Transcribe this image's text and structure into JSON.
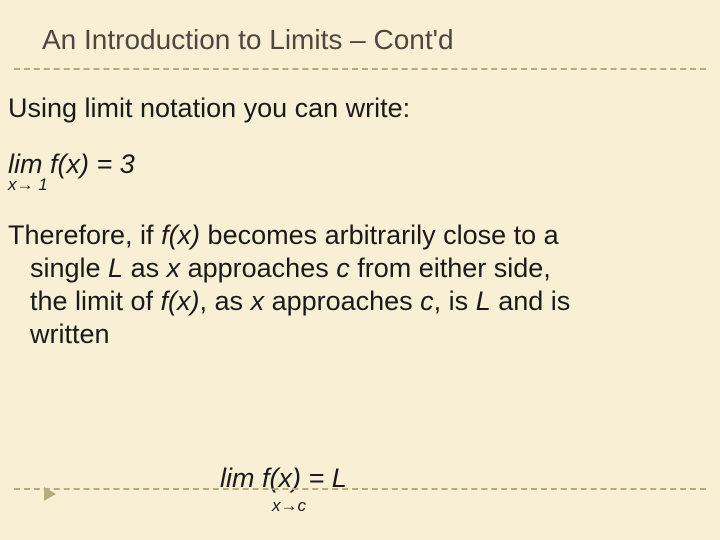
{
  "title": "An Introduction to Limits – Cont'd",
  "p1": "Using limit notation you can write:",
  "eq1_line": "lim  f(x) = 3",
  "eq1_sub": "x→ 1",
  "p2": {
    "l1": "Therefore, if ",
    "fx1": "f(x)",
    "l1b": " becomes arbitrarily close to a",
    "l2a": "single ",
    "L1": "L",
    "l2b": " as ",
    "x1": "x",
    "l2c": " approaches ",
    "c1": "c",
    "l2d": " from either side,",
    "l3a": "the limit of ",
    "fx2": "f(x)",
    "l3b": ", as ",
    "x2": "x",
    "l3c": " approaches ",
    "c2": "c",
    "l3d": ", is ",
    "L2": "L",
    "l3e": " and is",
    "l4": "written"
  },
  "eq2_line": "lim  f(x) = L",
  "eq2_sub": "x→c"
}
